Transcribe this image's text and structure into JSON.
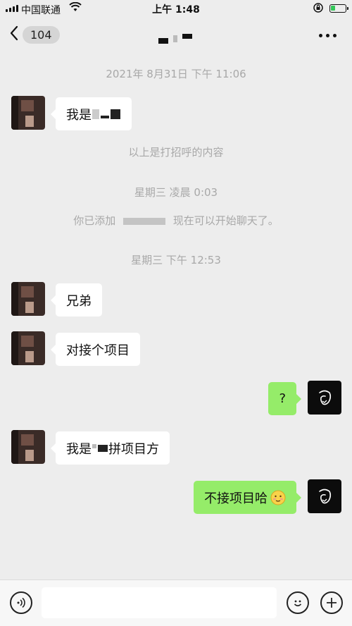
{
  "status_bar": {
    "carrier": "中国联通",
    "time": "上午 1:48"
  },
  "nav": {
    "back_count": "104"
  },
  "messages": {
    "ts1": "2021年 8月31日 下午 11:06",
    "m1": {
      "prefix": "我是",
      "suffix": ""
    },
    "sys1": "以上是打招呼的内容",
    "ts2": "星期三 凌晨 0:03",
    "sys2": {
      "prefix": "你已添加",
      "suffix": "现在可以开始聊天了。"
    },
    "ts3": "星期三 下午 12:53",
    "m2": "兄弟",
    "m3": "对接个项目",
    "m4": "?",
    "m5": {
      "prefix": "我是",
      "suffix": "拼项目方"
    },
    "m6": "不接项目哈"
  },
  "input": {
    "placeholder": ""
  },
  "colors": {
    "background": "#ededed",
    "bubble_self": "#95ec69",
    "bubble_other": "#ffffff",
    "system_text": "#a8a8a8"
  },
  "icons": [
    "signal-icon",
    "wifi-icon",
    "lock-rotation-icon",
    "battery-icon",
    "back-chevron-icon",
    "more-icon",
    "voice-icon",
    "emoji-icon",
    "plus-icon",
    "blushing-emoji-icon"
  ]
}
